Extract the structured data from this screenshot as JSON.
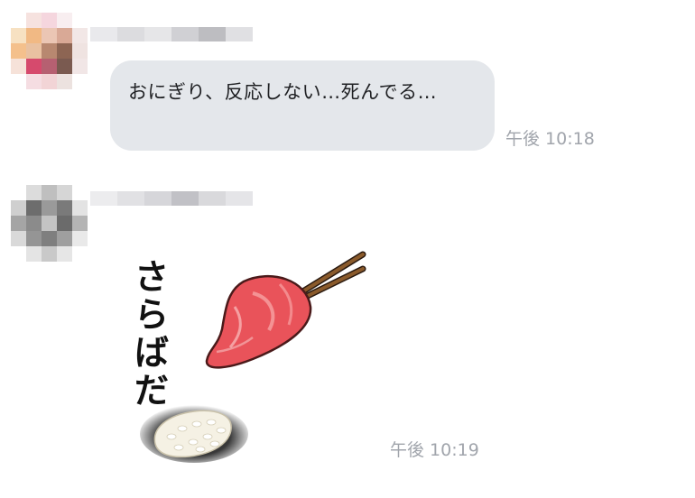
{
  "chat": {
    "messages": [
      {
        "sender_name": "",
        "type": "text",
        "text": "おにぎり、反応しない…死んでる…",
        "time": "午後 10:18"
      },
      {
        "sender_name": "",
        "type": "sticker",
        "sticker_text": "さらばだ",
        "time": "午後 10:19"
      }
    ]
  },
  "colors": {
    "bubble_bg": "#e4e7eb",
    "bubble_text": "#1f2023",
    "timestamp": "#a1a5ac",
    "background": "#ffffff"
  },
  "icons": {
    "sticker_art": "sushi-farewell-sticker"
  }
}
